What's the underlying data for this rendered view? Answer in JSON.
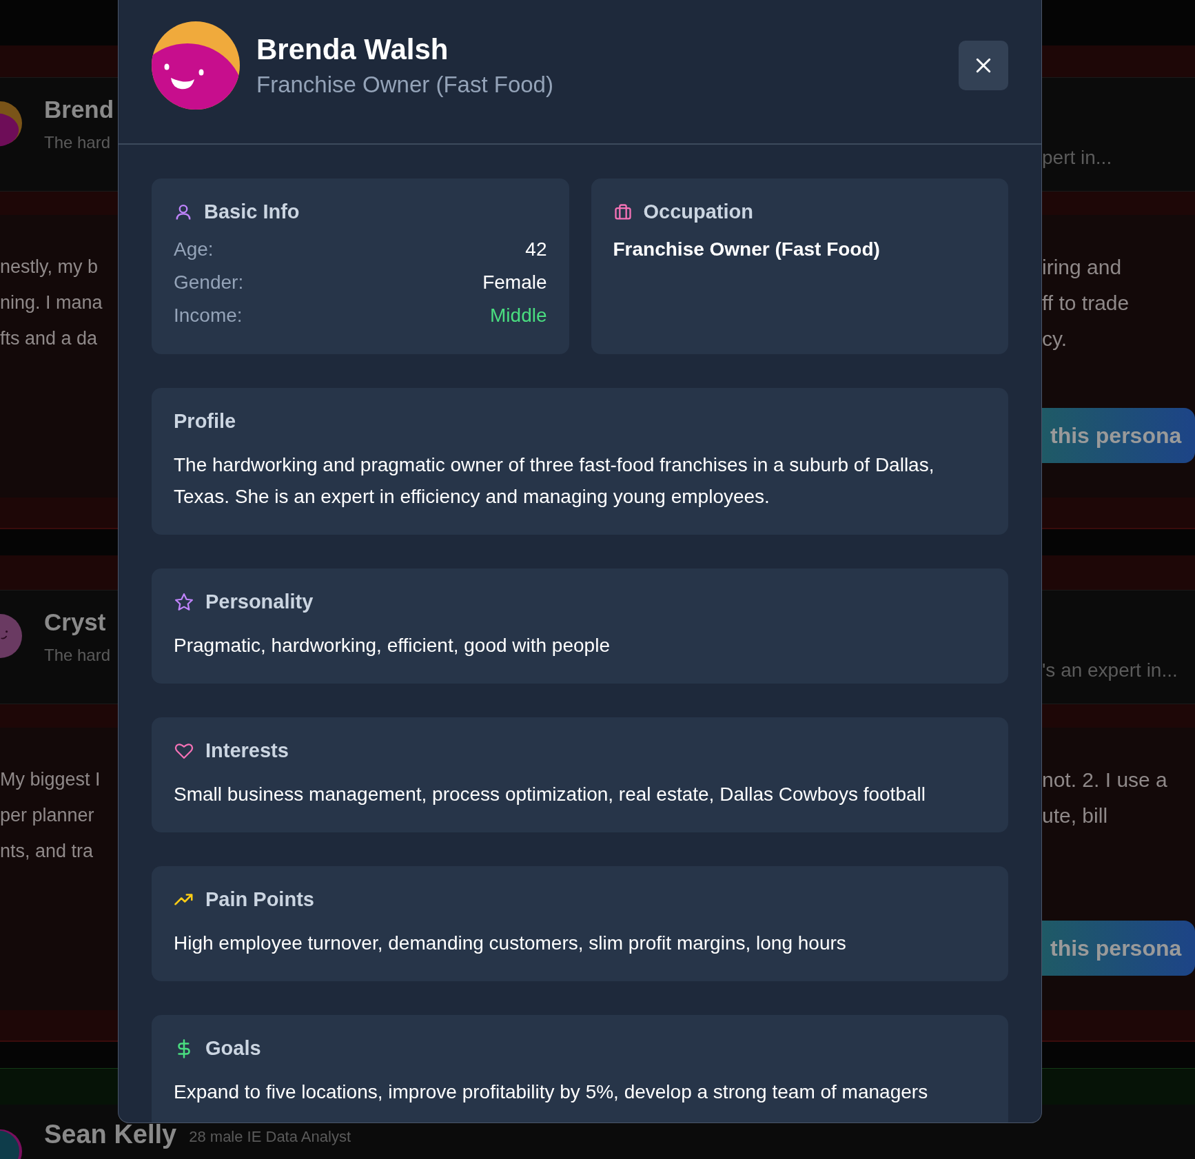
{
  "background": {
    "personas": [
      {
        "name": "Brend",
        "summary_left": "The hard",
        "summary_right": "pert in...",
        "quote_left": [
          "nestly, my b",
          "ning. I mana",
          "fts and a da"
        ],
        "quote_right": [
          "iring and",
          "ff to trade",
          "cy."
        ],
        "button": "this persona",
        "color": "#6e0d58"
      },
      {
        "name": "Cryst",
        "summary_left": "The hard",
        "summary_right": "'s an expert in...",
        "quote_left": [
          "My biggest I",
          "per planner",
          "nts, and tra"
        ],
        "quote_right": [
          "not. 2. I use a",
          "ute, bill"
        ],
        "button": "this persona",
        "color": "#6a3a62"
      }
    ],
    "next": {
      "name": "Sean Kelly",
      "meta": "28 male IE Data Analyst",
      "color": "#0e3c4a"
    }
  },
  "modal": {
    "name": "Brenda Walsh",
    "subtitle": "Franchise Owner (Fast Food)",
    "basic_info": {
      "title": "Basic Info",
      "fields": [
        {
          "label": "Age:",
          "value": "42",
          "highlight": false
        },
        {
          "label": "Gender:",
          "value": "Female",
          "highlight": false
        },
        {
          "label": "Income:",
          "value": "Middle",
          "highlight": true
        }
      ]
    },
    "occupation": {
      "title": "Occupation",
      "value": "Franchise Owner (Fast Food)"
    },
    "sections": [
      {
        "kind": "profile",
        "title": "Profile",
        "text": "The hardworking and pragmatic owner of three fast-food franchises in a suburb of Dallas, Texas. She is an expert in efficiency and managing young employees."
      },
      {
        "kind": "personality",
        "title": "Personality",
        "text": "Pragmatic, hardworking, efficient, good with people"
      },
      {
        "kind": "interests",
        "title": "Interests",
        "text": "Small business management, process optimization, real estate, Dallas Cowboys football"
      },
      {
        "kind": "pain_points",
        "title": "Pain Points",
        "text": "High employee turnover, demanding customers, slim profit margins, long hours"
      },
      {
        "kind": "goals",
        "title": "Goals",
        "text": "Expand to five locations, improve profitability by 5%, develop a strong team of managers"
      }
    ]
  }
}
